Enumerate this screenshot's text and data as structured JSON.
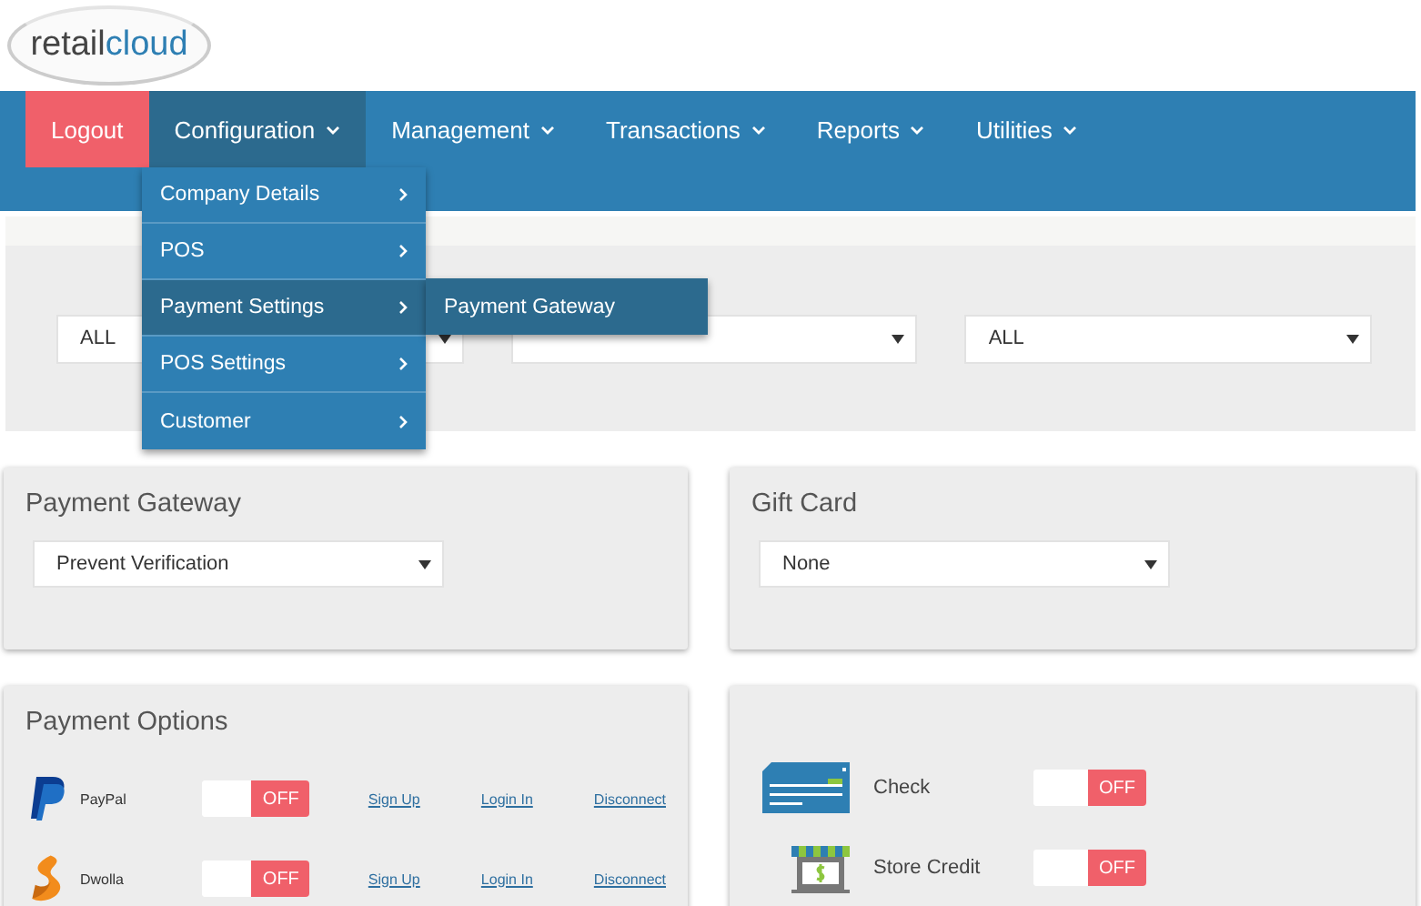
{
  "logo": {
    "parts": [
      "retail",
      "cloud"
    ]
  },
  "nav": {
    "items": [
      {
        "label": "Logout",
        "kind": "logout",
        "selected": false
      },
      {
        "label": "Configuration",
        "kind": "menu",
        "selected": true
      },
      {
        "label": "Management",
        "kind": "menu",
        "selected": false
      },
      {
        "label": "Transactions",
        "kind": "menu",
        "selected": false
      },
      {
        "label": "Reports",
        "kind": "menu",
        "selected": false
      },
      {
        "label": "Utilities",
        "kind": "menu",
        "selected": false
      }
    ]
  },
  "dropdown_menu": {
    "items": [
      {
        "label": "Company Details",
        "selected": false
      },
      {
        "label": "POS",
        "selected": false
      },
      {
        "label": "Payment Settings",
        "selected": true
      },
      {
        "label": "POS Settings",
        "selected": false
      },
      {
        "label": "Customer",
        "selected": false
      }
    ],
    "submenu": {
      "items": [
        {
          "label": "Payment Gateway"
        }
      ]
    }
  },
  "filters": [
    {
      "kind": "dropdown",
      "value": "ALL"
    },
    {
      "kind": "dropdown"
    },
    {
      "kind": "dropdown",
      "value": "ALL"
    }
  ],
  "cards": [
    {
      "title": "Payment Gateway",
      "select": "Prevent Verification"
    },
    {
      "title": "Gift Card",
      "select": "None"
    }
  ],
  "payment_options": {
    "title": "Payment Options",
    "rows": [
      {
        "name": "PayPal",
        "toggle": {
          "label": "OFF",
          "on": false
        },
        "links": [
          "Sign Up",
          "Login In",
          "Disconnect"
        ]
      },
      {
        "name": "Dwolla",
        "toggle": {
          "label": "OFF",
          "on": false
        },
        "links": [
          "Sign Up",
          "Login In",
          "Disconnect"
        ]
      }
    ]
  },
  "other_options": {
    "rows": [
      {
        "name": "Check",
        "toggle": {
          "label": "OFF",
          "on": false
        }
      },
      {
        "name": "Store Credit",
        "toggle": {
          "label": "OFF",
          "on": false
        }
      }
    ]
  }
}
